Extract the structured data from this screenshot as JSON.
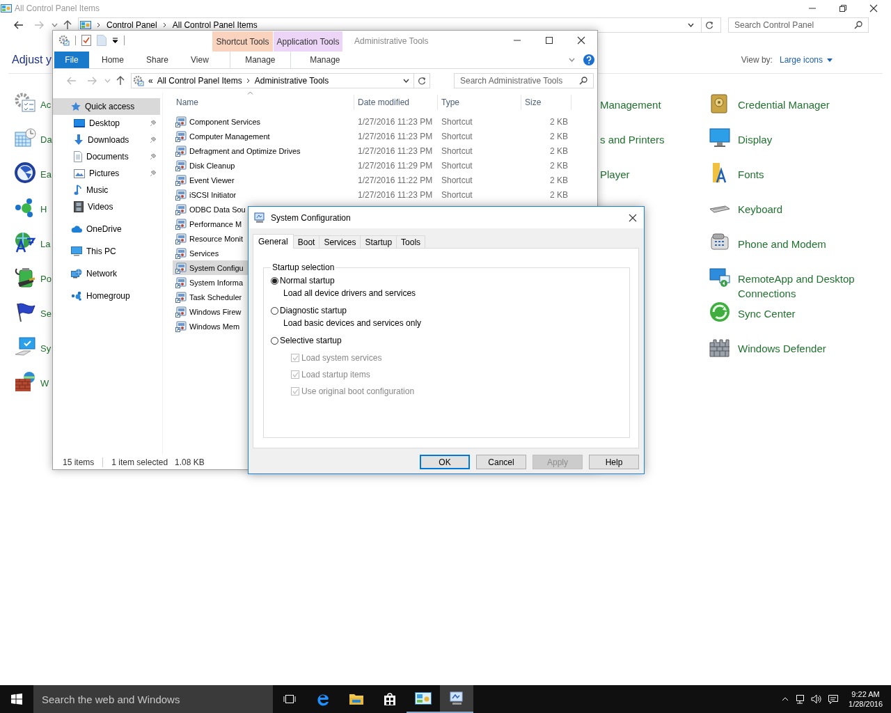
{
  "control_panel": {
    "title": "All Control Panel Items",
    "breadcrumb": [
      "Control Panel",
      "All Control Panel Items"
    ],
    "search": {
      "placeholder": "Search Control Panel"
    },
    "heading": "Adjust y",
    "view_by": {
      "label": "View by:",
      "value": "Large icons"
    },
    "columns": [
      [
        {
          "label": "Ac"
        },
        {
          "label": "Da"
        },
        {
          "label": "Ea"
        },
        {
          "label": "H"
        },
        {
          "label": "La"
        },
        {
          "label": "Po"
        },
        {
          "label": "Se"
        },
        {
          "label": "Sy"
        },
        {
          "label": "W"
        }
      ],
      [
        {
          "label": "Management"
        },
        {
          "label": "s and Printers"
        },
        {
          "label": "Player"
        }
      ],
      [
        {
          "label": "Credential Manager"
        },
        {
          "label": "Display"
        },
        {
          "label": "Fonts"
        },
        {
          "label": "Keyboard"
        },
        {
          "label": "Phone and Modem"
        },
        {
          "label": "RemoteApp and Desktop Connections"
        },
        {
          "label": "Sync Center"
        },
        {
          "label": "Windows Defender"
        }
      ]
    ]
  },
  "explorer": {
    "title": "Administrative Tools",
    "context_tabs": [
      {
        "label": "Shortcut Tools",
        "color": "#fad3bf"
      },
      {
        "label": "Application Tools",
        "color": "#ecd5f7"
      }
    ],
    "ribbon_tabs": [
      {
        "label": "File",
        "kind": "file"
      },
      {
        "label": "Home",
        "kind": "plain"
      },
      {
        "label": "Share",
        "kind": "plain"
      },
      {
        "label": "View",
        "kind": "plain"
      },
      {
        "label": "Manage",
        "kind": "context"
      },
      {
        "label": "Manage",
        "kind": "context"
      }
    ],
    "address": {
      "prefix": "«",
      "path": [
        "All Control Panel Items",
        "Administrative Tools"
      ]
    },
    "search": {
      "placeholder": "Search Administrative Tools"
    },
    "nav": [
      {
        "label": "Quick access",
        "selected": true,
        "children": [
          {
            "label": "Desktop",
            "selected": false,
            "pinned": true
          },
          {
            "label": "Downloads",
            "selected": false,
            "pinned": true
          },
          {
            "label": "Documents",
            "selected": false,
            "pinned": true
          },
          {
            "label": "Pictures",
            "selected": false,
            "pinned": true
          },
          {
            "label": "Music",
            "selected": false,
            "pinned": false
          },
          {
            "label": "Videos",
            "selected": false,
            "pinned": false
          }
        ]
      },
      {
        "label": "OneDrive",
        "selected": false
      },
      {
        "label": "This PC",
        "selected": false
      },
      {
        "label": "Network",
        "selected": false
      },
      {
        "label": "Homegroup",
        "selected": false
      }
    ],
    "columns": [
      "Name",
      "Date modified",
      "Type",
      "Size"
    ],
    "rows": [
      {
        "name": "Component Services",
        "date": "1/27/2016 11:23 PM",
        "type": "Shortcut",
        "size": "2 KB",
        "selected": false
      },
      {
        "name": "Computer Management",
        "date": "1/27/2016 11:23 PM",
        "type": "Shortcut",
        "size": "2 KB",
        "selected": false
      },
      {
        "name": "Defragment and Optimize Drives",
        "date": "1/27/2016 11:23 PM",
        "type": "Shortcut",
        "size": "2 KB",
        "selected": false
      },
      {
        "name": "Disk Cleanup",
        "date": "1/27/2016 11:29 PM",
        "type": "Shortcut",
        "size": "2 KB",
        "selected": false
      },
      {
        "name": "Event Viewer",
        "date": "1/27/2016 11:22 PM",
        "type": "Shortcut",
        "size": "2 KB",
        "selected": false
      },
      {
        "name": "iSCSI Initiator",
        "date": "1/27/2016 11:23 PM",
        "type": "Shortcut",
        "size": "2 KB",
        "selected": false
      },
      {
        "name": "ODBC Data Sou",
        "selected": false
      },
      {
        "name": "Performance M",
        "selected": false
      },
      {
        "name": "Resource Monit",
        "selected": false
      },
      {
        "name": "Services",
        "selected": false
      },
      {
        "name": "System Configu",
        "selected": true
      },
      {
        "name": "System Informa",
        "selected": false
      },
      {
        "name": "Task Scheduler",
        "selected": false
      },
      {
        "name": "Windows Firew",
        "selected": false
      },
      {
        "name": "Windows Mem",
        "selected": false
      }
    ],
    "status": {
      "count": "15 items",
      "selection": "1 item selected",
      "size": "1.08 KB"
    }
  },
  "dialog": {
    "title": "System Configuration",
    "tabs": [
      {
        "label": "General",
        "selected": true
      },
      {
        "label": "Boot",
        "selected": false
      },
      {
        "label": "Services",
        "selected": false
      },
      {
        "label": "Startup",
        "selected": false
      },
      {
        "label": "Tools",
        "selected": false
      }
    ],
    "group": "Startup selection",
    "options": [
      {
        "label": "Normal startup",
        "description": "Load all device drivers and services",
        "selected": true
      },
      {
        "label": "Diagnostic startup",
        "description": "Load basic devices and services only",
        "selected": false
      },
      {
        "label": "Selective startup",
        "selected": false
      }
    ],
    "checks": [
      {
        "label": "Load system services",
        "checked": true,
        "disabled": true
      },
      {
        "label": "Load startup items",
        "checked": true,
        "disabled": true
      },
      {
        "label": "Use original boot configuration",
        "checked": true,
        "disabled": true
      }
    ],
    "buttons": [
      {
        "label": "OK",
        "default": true,
        "disabled": false
      },
      {
        "label": "Cancel",
        "default": false,
        "disabled": false
      },
      {
        "label": "Apply",
        "default": false,
        "disabled": true
      },
      {
        "label": "Help",
        "default": false,
        "disabled": false
      }
    ]
  },
  "taskbar": {
    "search": {
      "placeholder": "Search the web and Windows"
    },
    "apps": [
      {
        "kind": "task-view",
        "running": false,
        "active": false
      },
      {
        "kind": "browser",
        "running": false,
        "active": false
      },
      {
        "kind": "folder",
        "running": false,
        "active": false
      },
      {
        "kind": "store",
        "running": false,
        "active": false
      },
      {
        "kind": "control-panel",
        "running": true,
        "active": false
      },
      {
        "kind": "system-config",
        "running": true,
        "active": true
      }
    ],
    "time": "9:22 AM",
    "date": "1/28/2016"
  }
}
